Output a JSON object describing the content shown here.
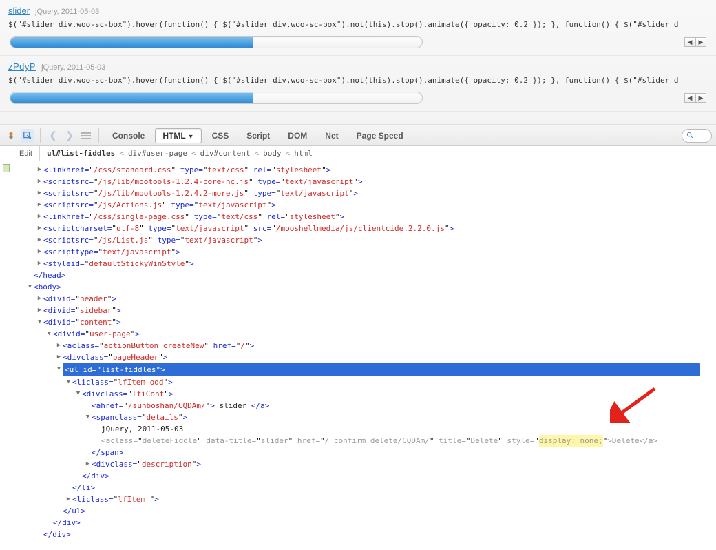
{
  "fiddles": [
    {
      "title": "slider",
      "meta": "jQuery, 2011-05-03",
      "code": "$(\"#slider div.woo-sc-box\").hover(function() { $(\"#slider div.woo-sc-box\").not(this).stop().animate({ opacity: 0.2 }); }, function() { $(\"#slider d",
      "progress_percent": 59
    },
    {
      "title": "zPdyP",
      "meta": "jQuery, 2011-05-03",
      "code": "$(\"#slider div.woo-sc-box\").hover(function() { $(\"#slider div.woo-sc-box\").not(this).stop().animate({ opacity: 0.2 }); }, function() { $(\"#slider d",
      "progress_percent": 59
    }
  ],
  "devtools": {
    "tabs": [
      "Console",
      "HTML",
      "CSS",
      "Script",
      "DOM",
      "Net",
      "Page Speed"
    ],
    "active_tab": "HTML",
    "edit_label": "Edit",
    "breadcrumb": [
      "ul#list-fiddles",
      "<",
      "div#user-page",
      "<",
      "div#content",
      "<",
      "body",
      "<",
      "html"
    ]
  },
  "tree": {
    "r0": {
      "tag": "link",
      "a1": "href",
      "v1": "/css/standard.css",
      "a2": "type",
      "v2": "text/css",
      "a3": "rel",
      "v3": "stylesheet"
    },
    "r1": {
      "tag": "script",
      "a1": "src",
      "v1": "/js/lib/mootools-1.2.4-core-nc.js",
      "a2": "type",
      "v2": "text/javascript"
    },
    "r2": {
      "tag": "script",
      "a1": "src",
      "v1": "/js/lib/mootools-1.2.4.2-more.js",
      "a2": "type",
      "v2": "text/javascript"
    },
    "r3": {
      "tag": "script",
      "a1": "src",
      "v1": "/js/Actions.js",
      "a2": "type",
      "v2": "text/javascript"
    },
    "r4": {
      "tag": "link",
      "a1": "href",
      "v1": "/css/single-page.css",
      "a2": "type",
      "v2": "text/css",
      "a3": "rel",
      "v3": "stylesheet"
    },
    "r5": {
      "tag": "script",
      "a1": "charset",
      "v1": "utf-8",
      "a2": "type",
      "v2": "text/javascript",
      "a3": "src",
      "v3": "/mooshellmedia/js/clientcide.2.2.0.js"
    },
    "r6": {
      "tag": "script",
      "a1": "src",
      "v1": "/js/List.js",
      "a2": "type",
      "v2": "text/javascript"
    },
    "r7": {
      "tag": "script",
      "a1": "type",
      "v1": "text/javascript"
    },
    "r8": {
      "tag": "style",
      "a1": "id",
      "v1": "defaultStickyWinStyle"
    },
    "r_headc": "</head>",
    "r_body": {
      "tag": "body"
    },
    "r_header": {
      "tag": "div",
      "a1": "id",
      "v1": "header"
    },
    "r_sidebar": {
      "tag": "div",
      "a1": "id",
      "v1": "sidebar"
    },
    "r_content": {
      "tag": "div",
      "a1": "id",
      "v1": "content"
    },
    "r_userpage": {
      "tag": "div",
      "a1": "id",
      "v1": "user-page"
    },
    "r_actbtn": {
      "tag": "a",
      "a1": "class",
      "v1": "actionButton createNew",
      "a2": "href",
      "v2": "/"
    },
    "r_pagehdr": {
      "tag": "div",
      "a1": "class",
      "v1": "pageHeader"
    },
    "r_ul": {
      "tag": "ul",
      "a1": "id",
      "v1": "list-fiddles"
    },
    "r_li_odd": {
      "tag": "li",
      "a1": "class",
      "v1": "lfItem odd"
    },
    "r_cont": {
      "tag": "div",
      "a1": "class",
      "v1": "lfiCont"
    },
    "r_slider_a": {
      "tag": "a",
      "a1": "href",
      "v1": "/sunboshan/CQDAm/",
      "txt": " slider ",
      "close": "</a>"
    },
    "r_details": {
      "tag": "span",
      "a1": "class",
      "v1": "details"
    },
    "r_details_txt": "jQuery, 2011-05-03",
    "r_delete": {
      "tag": "a",
      "a1": "class",
      "v1": "deleteFiddle",
      "a2": "data-title",
      "v2": "slider",
      "a3": "href",
      "v3": "/_confirm_delete/CQDAm/",
      "a4": "title",
      "v4": "Delete",
      "a5": "style",
      "v5": "display: none;",
      "txt": "Delete",
      "close": "</a>"
    },
    "r_span_c": "</span>",
    "r_desc": {
      "tag": "div",
      "a1": "class",
      "v1": "description"
    },
    "r_div_c": "</div>",
    "r_li_c": "</li>",
    "r_li2": {
      "tag": "li",
      "a1": "class",
      "v1": "lfItem "
    },
    "r_ul_c": "</ul>"
  }
}
